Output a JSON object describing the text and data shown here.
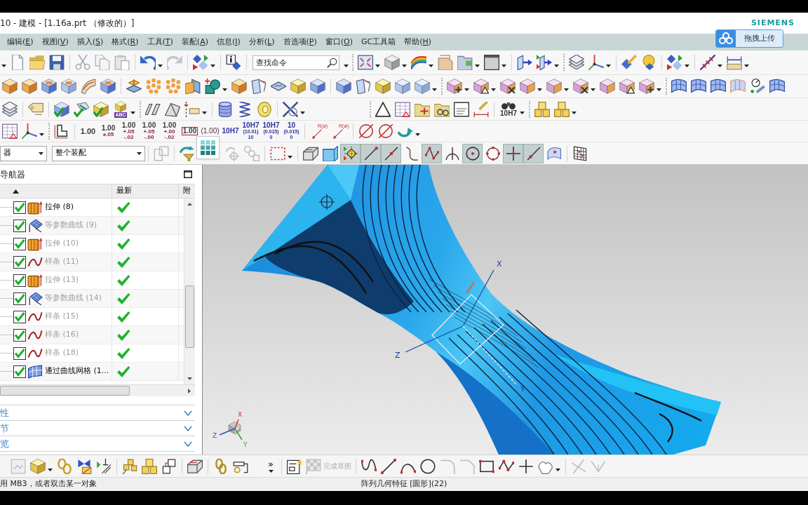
{
  "title_bar": {
    "title": "10 - 建模 - [1.16a.prt （修改的）]",
    "brand": "SIEMENS"
  },
  "upload_button": {
    "label": "拖拽上传"
  },
  "menu": [
    {
      "parts": [
        "编辑(",
        "E",
        ")"
      ]
    },
    {
      "parts": [
        "视图(",
        "V",
        ")"
      ]
    },
    {
      "parts": [
        "插入(",
        "S",
        ")"
      ]
    },
    {
      "parts": [
        "格式(",
        "R",
        ")"
      ]
    },
    {
      "parts": [
        "工具(",
        "T",
        ")"
      ]
    },
    {
      "parts": [
        "装配(",
        "A",
        ")"
      ]
    },
    {
      "parts": [
        "信息(",
        "I",
        ")"
      ]
    },
    {
      "parts": [
        "分析(",
        "L",
        ")"
      ]
    },
    {
      "parts": [
        "首选项(",
        "P",
        ")"
      ]
    },
    {
      "parts": [
        "窗口(",
        "O",
        ")"
      ]
    },
    {
      "parts": [
        "GC工具箱"
      ]
    },
    {
      "parts": [
        "帮助(",
        "H",
        ")"
      ]
    }
  ],
  "toolbar": {
    "search": {
      "placeholder": "查找命令"
    },
    "label_tool": "ABC",
    "fit_tool": "10H7",
    "dimension_styles": [
      {
        "kind": "plain",
        "lines": [
          "1.00"
        ]
      },
      {
        "kind": "tolerance",
        "lines": [
          "1.00",
          "±.05"
        ]
      },
      {
        "kind": "tolerance",
        "lines": [
          "1.00",
          "+.05",
          "-.02"
        ]
      },
      {
        "kind": "tolerance",
        "lines": [
          "1.00",
          "+.05",
          "-.00"
        ]
      },
      {
        "kind": "tolerance",
        "lines": [
          "1.00",
          "+.00",
          "-.02"
        ]
      },
      {
        "kind": "boxed",
        "lines": [
          "1.00"
        ]
      },
      {
        "kind": "reference",
        "lines": [
          "(1.00)"
        ]
      },
      {
        "kind": "fit",
        "lines": [
          "10H7"
        ]
      },
      {
        "kind": "fit",
        "lines": [
          "10H7",
          "(10.01)",
          "10"
        ]
      },
      {
        "kind": "fit",
        "lines": [
          "10H7",
          "(0.015)",
          "0"
        ]
      },
      {
        "kind": "fit",
        "lines": [
          "10",
          "(0.015)",
          "0"
        ]
      }
    ],
    "radius_styles": [
      "R(ø)",
      "R(ø)"
    ]
  },
  "selection_bar": {
    "filter": "器",
    "scope": "整个装配",
    "snap_points": [
      {
        "on": true
      },
      {
        "on": true
      },
      {
        "on": true
      },
      {
        "on": false
      },
      {
        "on": true
      },
      {
        "on": false
      },
      {
        "on": true
      },
      {
        "on": false
      },
      {
        "on": true
      },
      {
        "on": true
      },
      {
        "on": false
      }
    ]
  },
  "navigator": {
    "title": "导航器",
    "columns": [
      "最新",
      "附"
    ],
    "rows": [
      {
        "kind": "extrude",
        "label": "拉伸 (8)",
        "checked": true,
        "dimmed": false,
        "up_to_date": true
      },
      {
        "kind": "isoparametric",
        "label": "等参数曲线 (9)",
        "checked": true,
        "dimmed": true,
        "up_to_date": true
      },
      {
        "kind": "extrude",
        "label": "拉伸 (10)",
        "checked": true,
        "dimmed": true,
        "up_to_date": true
      },
      {
        "kind": "spline",
        "label": "样条 (11)",
        "checked": true,
        "dimmed": true,
        "up_to_date": true
      },
      {
        "kind": "extrude",
        "label": "拉伸 (13)",
        "checked": true,
        "dimmed": true,
        "up_to_date": true
      },
      {
        "kind": "isoparametric",
        "label": "等参数曲线 (14)",
        "checked": true,
        "dimmed": true,
        "up_to_date": true
      },
      {
        "kind": "spline",
        "label": "样条 (15)",
        "checked": true,
        "dimmed": true,
        "up_to_date": true
      },
      {
        "kind": "spline",
        "label": "样条 (16)",
        "checked": true,
        "dimmed": true,
        "up_to_date": true
      },
      {
        "kind": "spline",
        "label": "样条 (18)",
        "checked": true,
        "dimmed": true,
        "up_to_date": true
      },
      {
        "kind": "mesh",
        "label": "通过曲线网格 (1...",
        "checked": true,
        "dimmed": false,
        "up_to_date": true
      }
    ],
    "sections": [
      {
        "label": "性",
        "expanded": false
      },
      {
        "label": "节",
        "expanded": false
      },
      {
        "label": "览",
        "expanded": false
      }
    ]
  },
  "bottom_toolbar": {
    "overflow": "»",
    "finish_sketch": {
      "label": "完成草图",
      "disabled": true
    }
  },
  "viewport": {
    "csys_labels": [
      "X",
      "Z",
      "Y"
    ],
    "triad_labels": [
      "X",
      "Z",
      "Y"
    ]
  },
  "status_bar": {
    "prompt": "用 MB3，或者双击某一对象",
    "message": "阵列几何特征 [圆形](22)"
  }
}
